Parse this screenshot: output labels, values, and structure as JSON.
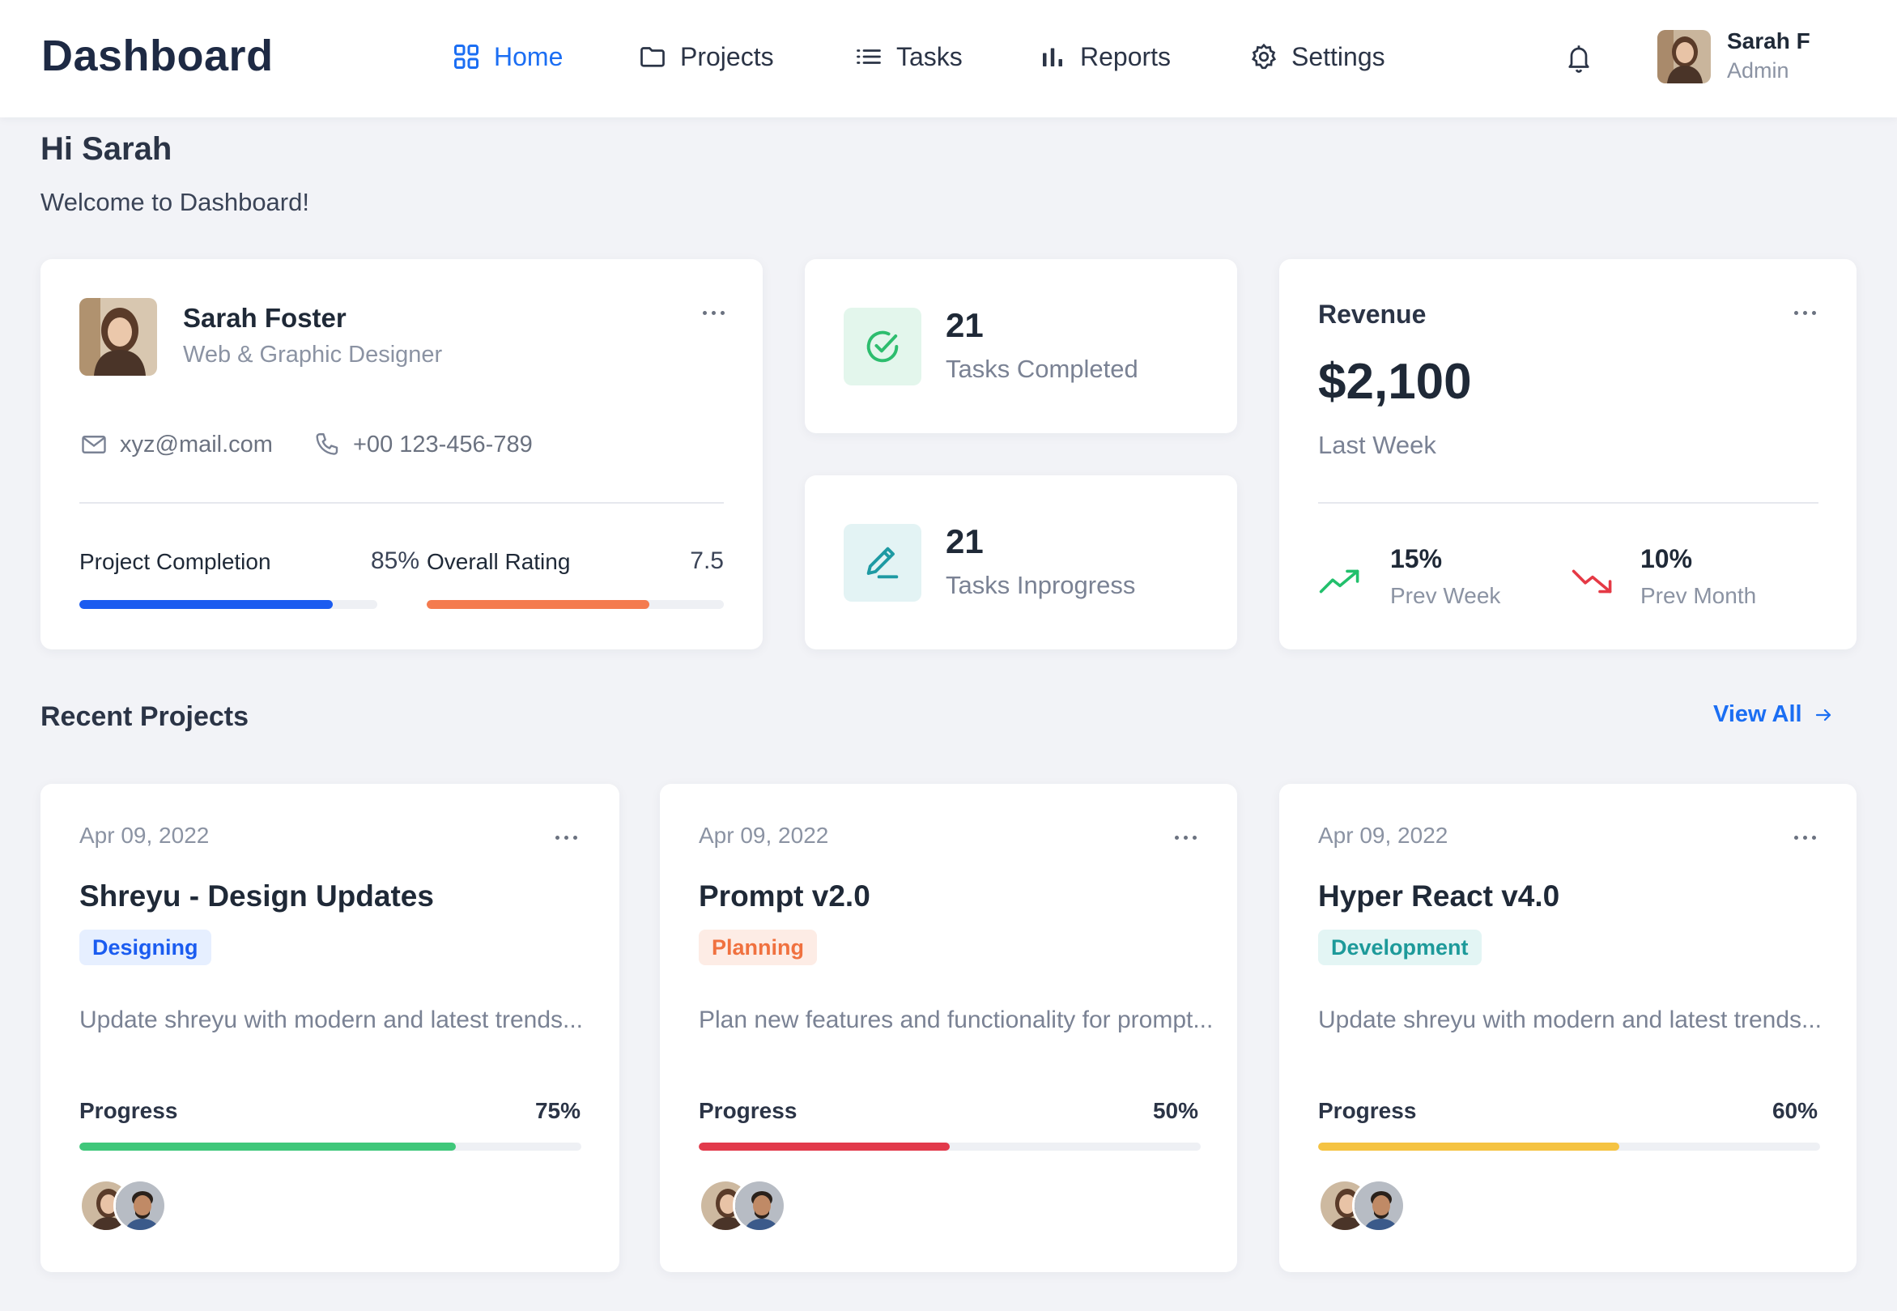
{
  "app": {
    "brand": "Dashboard"
  },
  "nav": {
    "items": [
      {
        "label": "Home",
        "icon": "grid-icon",
        "active": true
      },
      {
        "label": "Projects",
        "icon": "folder-icon",
        "active": false
      },
      {
        "label": "Tasks",
        "icon": "list-icon",
        "active": false
      },
      {
        "label": "Reports",
        "icon": "bar-chart-icon",
        "active": false
      },
      {
        "label": "Settings",
        "icon": "gear-icon",
        "active": false
      }
    ]
  },
  "user": {
    "name": "Sarah F",
    "role": "Admin"
  },
  "greeting": {
    "title": "Hi Sarah",
    "subtitle": "Welcome to Dashboard!"
  },
  "profile": {
    "name": "Sarah Foster",
    "role": "Web & Graphic Designer",
    "email": "xyz@mail.com",
    "phone": "+00 123-456-789",
    "completion": {
      "label": "Project Completion",
      "value": "85%",
      "fraction": 0.85
    },
    "rating": {
      "label": "Overall Rating",
      "value": "7.5",
      "fraction": 0.75
    }
  },
  "tasks": {
    "completed": {
      "count": "21",
      "label": "Tasks Completed"
    },
    "inprogress": {
      "count": "21",
      "label": "Tasks Inprogress"
    }
  },
  "revenue": {
    "title": "Revenue",
    "amount": "$2,100",
    "period": "Last Week",
    "prev_week": {
      "value": "15%",
      "label": "Prev Week",
      "direction": "up"
    },
    "prev_month": {
      "value": "10%",
      "label": "Prev Month",
      "direction": "down"
    }
  },
  "recent": {
    "title": "Recent Projects",
    "view_all": "View All",
    "projects": [
      {
        "date": "Apr 09, 2022",
        "title": "Shreyu - Design Updates",
        "badge": "Designing",
        "description": "Update shreyu with modern and latest trends...",
        "progress_label": "Progress",
        "progress_value": "75%",
        "progress_fraction": 0.75
      },
      {
        "date": "Apr 09, 2022",
        "title": "Prompt v2.0",
        "badge": "Planning",
        "description": "Plan new features and functionality for prompt...",
        "progress_label": "Progress",
        "progress_value": "50%",
        "progress_fraction": 0.5
      },
      {
        "date": "Apr 09, 2022",
        "title": "Hyper React v4.0",
        "badge": "Development",
        "description": "Update shreyu with modern and latest trends...",
        "progress_label": "Progress",
        "progress_value": "60%",
        "progress_fraction": 0.6
      }
    ]
  },
  "colors": {
    "accent": "#1b6ef3",
    "completion_bar": "#1b5cf0",
    "rating_bar": "#f47b4f",
    "trend_up": "#22c06c",
    "trend_down": "#e53945",
    "progress_green": "#3fc77a",
    "progress_red": "#e23a4b",
    "progress_yellow": "#f5c342",
    "badge_designing_bg": "#e6efff",
    "badge_designing_fg": "#1b5cf0",
    "badge_planning_bg": "#fdece5",
    "badge_planning_fg": "#f0713f",
    "badge_development_bg": "#e3f5f4",
    "badge_development_fg": "#1d9a9a"
  }
}
